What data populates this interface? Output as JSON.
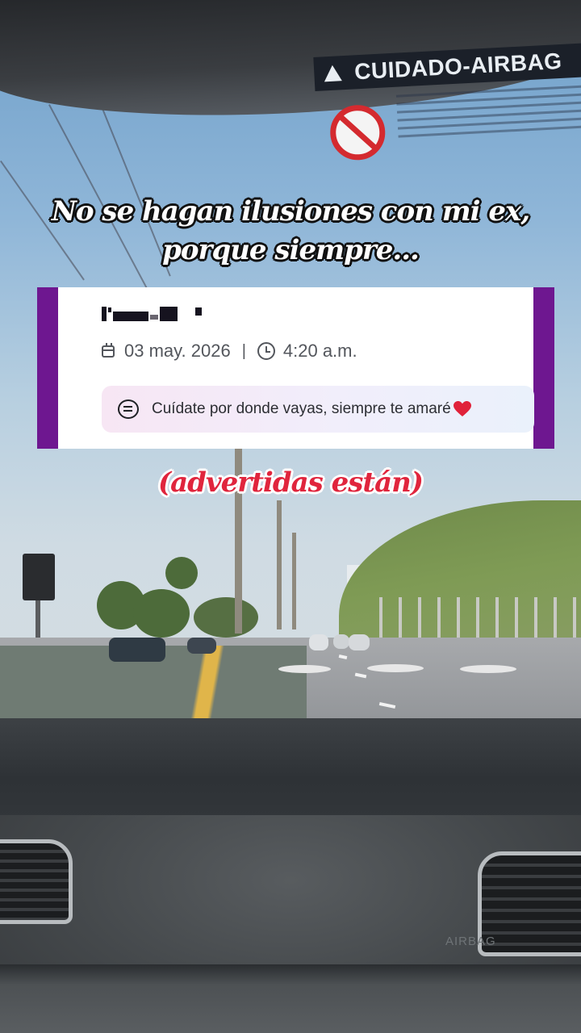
{
  "overlay": {
    "caption_top_line1": "No se hagan ilusiones con mi ex,",
    "caption_top_line2": "porque siempre...",
    "caption_bottom": "(advertidas están)"
  },
  "card": {
    "date": "03 may. 2026",
    "separator": "|",
    "time": "4:20 a.m.",
    "message": "Cuídate por donde vayas, siempre te amaré",
    "heart_color": "#e0223a",
    "border_color": "#6e1790",
    "date_icon": "calendar-icon",
    "time_icon": "clock-icon",
    "message_icon": "chat-bubble-icon"
  },
  "background": {
    "sticker_text": "CUIDADO-AIRBAG",
    "dashboard_text": "AIRBAG"
  }
}
